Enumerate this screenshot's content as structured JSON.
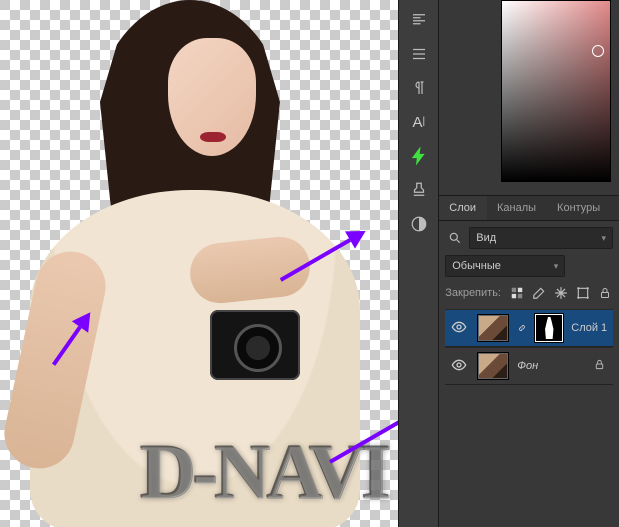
{
  "watermark_text": "D-NAVI",
  "toolstrip": {
    "items": [
      {
        "name": "paragraph-align-icon"
      },
      {
        "name": "line-spacing-icon"
      },
      {
        "name": "pilcrow-icon"
      },
      {
        "name": "character-icon",
        "glyph": "A|"
      },
      {
        "name": "flash-icon"
      },
      {
        "name": "stamp-icon"
      },
      {
        "name": "adjustments-icon"
      }
    ]
  },
  "tabs": {
    "layers": "Слои",
    "channels": "Каналы",
    "paths": "Контуры",
    "active": "layers"
  },
  "filter": {
    "search_placeholder": "Вид"
  },
  "blend_mode": {
    "value": "Обычные"
  },
  "lock": {
    "label": "Закрепить:"
  },
  "layers": [
    {
      "id": "layer-1",
      "name": "Слой 1",
      "visible": true,
      "has_mask": true,
      "active": true
    },
    {
      "id": "background",
      "name": "Фон",
      "visible": true,
      "has_mask": false,
      "active": false,
      "locked": true
    }
  ]
}
